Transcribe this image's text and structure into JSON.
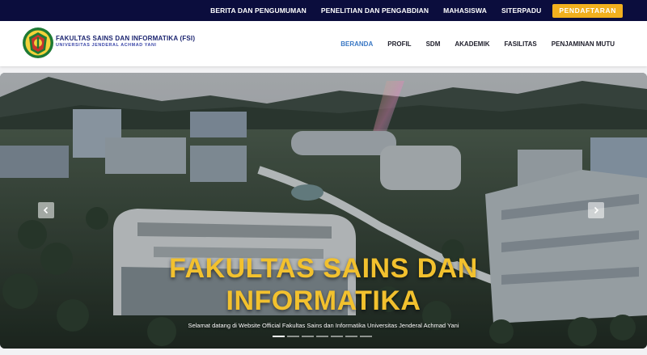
{
  "topbar": {
    "links": [
      "BERITA DAN PENGUMUMAN",
      "PENELITIAN DAN PENGABDIAN",
      "MAHASISWA",
      "SITERPADU"
    ],
    "cta": "PENDAFTARAN"
  },
  "brand": {
    "title": "FAKULTAS SAINS DAN INFORMATIKA (FSI)",
    "subtitle": "UNIVERSITAS JENDERAL ACHMAD YANI",
    "logo_icon": "unjani-crest-icon"
  },
  "nav": {
    "items": [
      "BERANDA",
      "PROFIL",
      "SDM",
      "AKADEMIK",
      "FASILITAS",
      "PENJAMINAN MUTU"
    ],
    "active_index": 0
  },
  "hero": {
    "title_line1": "FAKULTAS SAINS DAN",
    "title_line2": "INFORMATIKA",
    "subtitle": "Selamat datang di Website Official Fakultas Sains dan Informatika Universitas Jenderal Achmad Yani",
    "slide_count": 7,
    "active_slide": 0,
    "prev_icon": "chevron-left-icon",
    "next_icon": "chevron-right-icon"
  },
  "colors": {
    "topbar_bg": "#0b0d3d",
    "cta_bg": "#f2b01e",
    "active_nav": "#3a78c4",
    "hero_title": "#f2c12e"
  }
}
